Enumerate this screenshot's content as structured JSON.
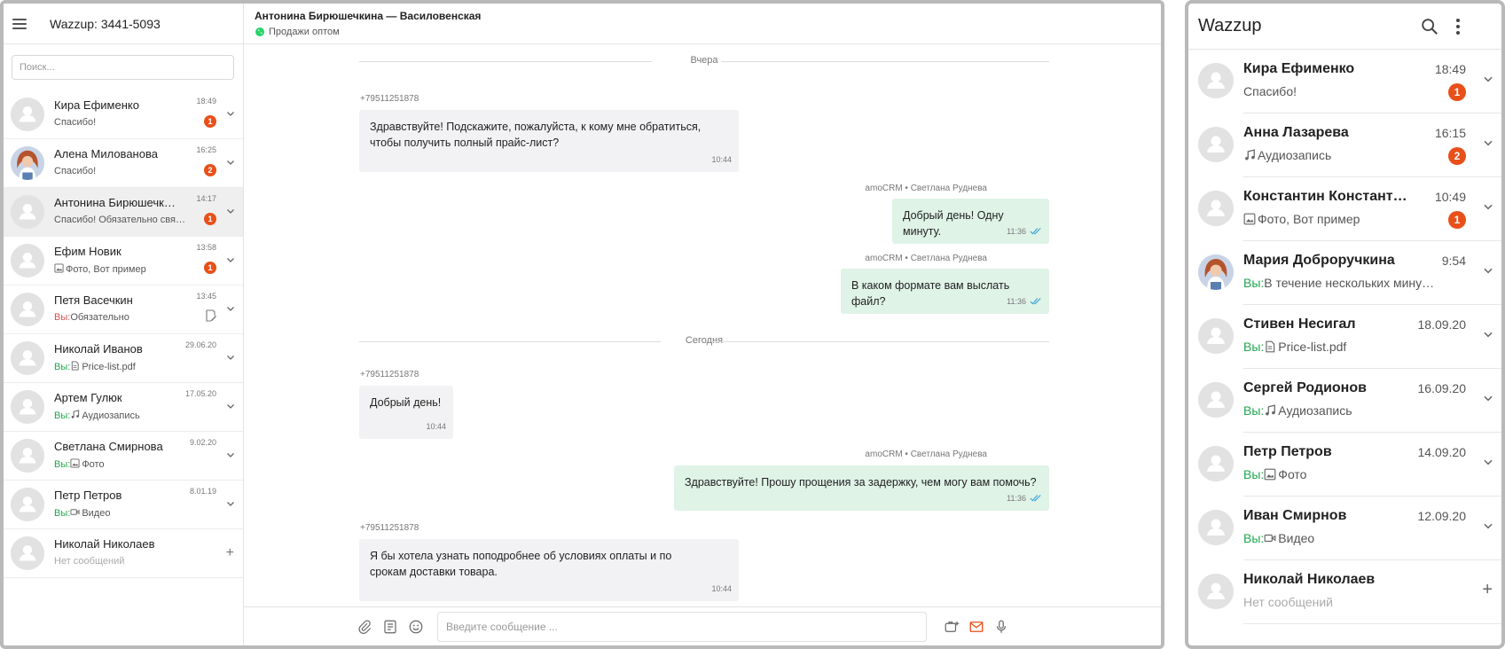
{
  "desktop": {
    "app_title": "Wazzup: 3441-5093",
    "search_placeholder": "Поиск...",
    "you_label": "Вы:",
    "chats": [
      {
        "name": "Кира Ефименко",
        "time": "18:49",
        "preview": "Спасибо!",
        "badge": "1",
        "avatar": "placeholder"
      },
      {
        "name": "Алена Милованова",
        "time": "16:25",
        "preview": "Спасибо!",
        "badge": "2",
        "avatar": "photo"
      },
      {
        "name": "Антонина Бирюшечкина",
        "time": "14:17",
        "preview": "Спасибо! Обязательно свяжусь",
        "badge": "1",
        "avatar": "placeholder",
        "selected": true
      },
      {
        "name": "Ефим Новик",
        "time": "13:58",
        "preview": "Фото, Вот пример",
        "badge": "1",
        "avatar": "placeholder",
        "icon": "image-icon"
      },
      {
        "name": "Петя Васечкин",
        "time": "13:45",
        "preview": "Обязательно",
        "you": true,
        "draft": true,
        "avatar": "placeholder"
      },
      {
        "name": "Николай Иванов",
        "time": "29.06.20",
        "preview": "Price-list.pdf",
        "you": true,
        "icon": "file-icon",
        "avatar": "placeholder"
      },
      {
        "name": "Артем Гулюк",
        "time": "17.05.20",
        "preview": "Аудиозапись",
        "you": true,
        "icon": "music-icon",
        "avatar": "placeholder"
      },
      {
        "name": "Светлана Смирнова",
        "time": "9.02.20",
        "preview": "Фото",
        "you": true,
        "icon": "image-icon",
        "avatar": "placeholder"
      },
      {
        "name": "Петр Петров",
        "time": "8.01.19",
        "preview": "Видео",
        "you": true,
        "icon": "video-icon",
        "avatar": "placeholder"
      },
      {
        "name": "Николай Николаев",
        "time": "",
        "preview": "Нет сообщений",
        "empty": true,
        "avatar": "placeholder"
      }
    ],
    "conversation": {
      "title": "Антонина Бирюшечкина — Василовенская",
      "channel": "Продажи оптом",
      "day_yesterday": "Вчера",
      "day_today": "Сегодня",
      "messages": [
        {
          "dir": "in",
          "sender": "+79511251878",
          "text": "Здравствуйте! Подскажите, пожалуйста, к кому мне обратиться, чтобы получить полный прайс-лист?",
          "time": "10:44"
        },
        {
          "dir": "out",
          "sender": "amoCRM • Светлана Руднева",
          "text": "Добрый день! Одну минуту.",
          "time": "11:36"
        },
        {
          "dir": "out",
          "sender": "amoCRM • Светлана Руднева",
          "text": "В каком формате вам выслать файл?",
          "time": "11:36"
        },
        {
          "dir": "in",
          "sender": "+79511251878",
          "text": "Добрый день!",
          "time": "10:44"
        },
        {
          "dir": "out",
          "sender": "amoCRM • Светлана Руднева",
          "text": "Здравствуйте! Прошу прощения за задержку, чем могу вам помочь?",
          "time": "11:36"
        },
        {
          "dir": "in",
          "sender": "+79511251878",
          "text": "Я бы хотела узнать поподробнее об условиях оплаты и по срокам доставки товара.",
          "time": "10:44"
        }
      ]
    },
    "composer_placeholder": "Введите сообщение ..."
  },
  "mobile": {
    "app_title": "Wazzup",
    "you_label": "Вы:",
    "chats": [
      {
        "name": "Кира Ефименко",
        "time": "18:49",
        "preview": "Спасибо!",
        "badge": "1",
        "avatar": "placeholder"
      },
      {
        "name": "Анна Лазарева",
        "time": "16:15",
        "preview": "Аудиозапись",
        "badge": "2",
        "icon": "music-icon",
        "avatar": "placeholder"
      },
      {
        "name": "Константин Константинов",
        "time": "10:49",
        "preview": "Фото, Вот пример",
        "badge": "1",
        "icon": "image-icon",
        "avatar": "placeholder"
      },
      {
        "name": "Мария Доброручкина",
        "time": "9:54",
        "preview": "В течение нескольких минут вам ответим",
        "you": true,
        "avatar": "photo"
      },
      {
        "name": "Стивен Несигал",
        "time": "18.09.20",
        "preview": "Price-list.pdf",
        "you": true,
        "icon": "file-icon",
        "avatar": "placeholder"
      },
      {
        "name": "Сергей Родионов",
        "time": "16.09.20",
        "preview": "Аудиозапись",
        "you": true,
        "icon": "music-icon",
        "avatar": "placeholder"
      },
      {
        "name": "Петр Петров",
        "time": "14.09.20",
        "preview": "Фото",
        "you": true,
        "icon": "image-icon",
        "avatar": "placeholder"
      },
      {
        "name": "Иван Смирнов",
        "time": "12.09.20",
        "preview": "Видео",
        "you": true,
        "icon": "video-icon",
        "avatar": "placeholder"
      },
      {
        "name": "Николай Николаев",
        "time": "",
        "preview": "Нет сообщений",
        "empty": true,
        "avatar": "placeholder"
      }
    ]
  },
  "colors": {
    "badge": "#e8501a",
    "outgoing_bubble": "#dff3e7",
    "incoming_bubble": "#f2f2f4",
    "you_label": "#1fa64d",
    "whatsapp": "#25d366"
  }
}
